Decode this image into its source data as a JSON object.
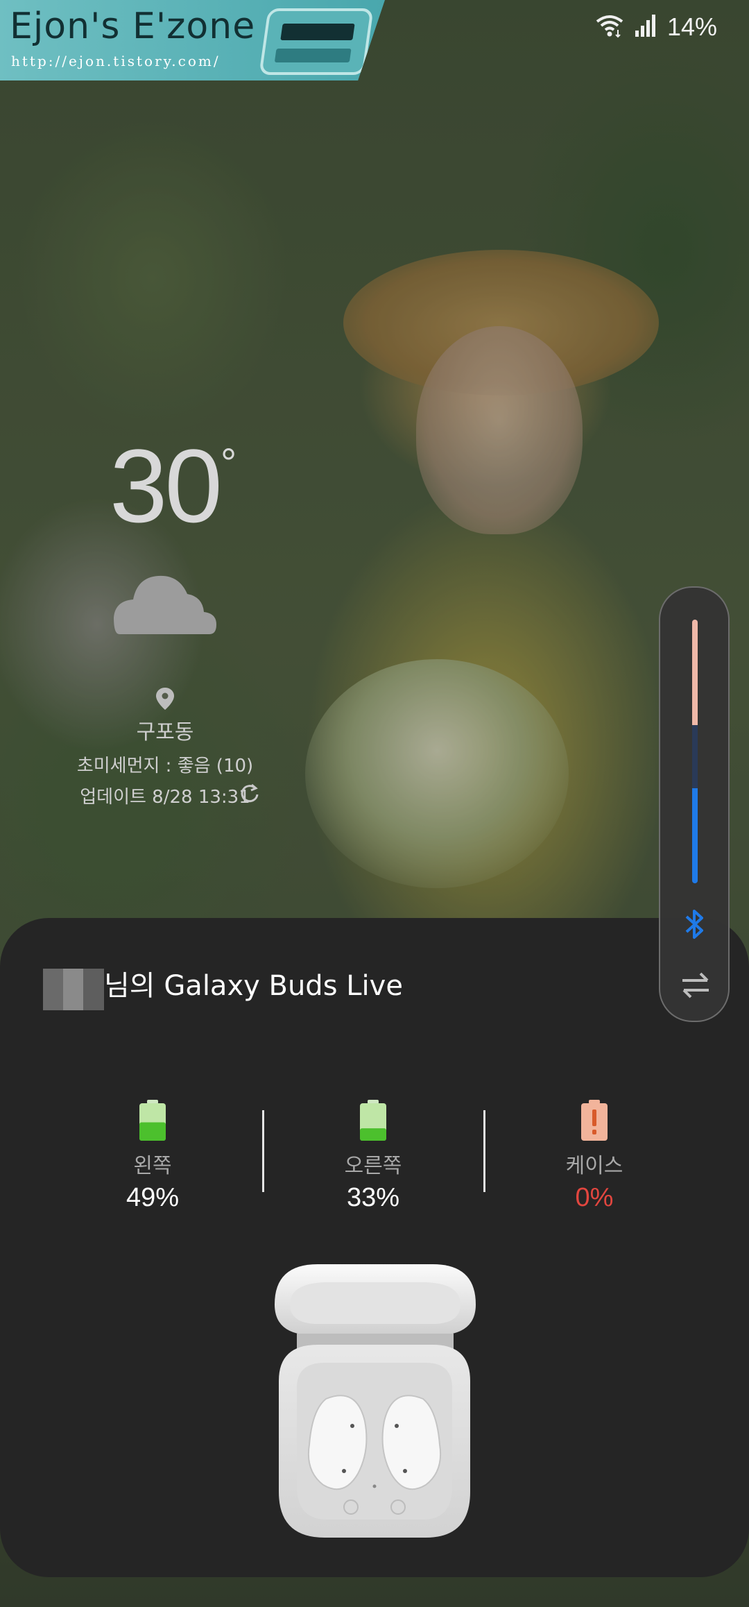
{
  "blog_badge": {
    "title": "Ejon's E'zone",
    "url": "http://ejon.tistory.com/"
  },
  "status_bar": {
    "battery_percent": "14%",
    "icons": [
      "wifi-icon",
      "signal-icon"
    ]
  },
  "weather": {
    "temperature": "30",
    "degree_symbol": "°",
    "condition_icon": "cloud-icon",
    "location": "구포동",
    "air_quality": "초미세먼지 : 좋음 (10)",
    "updated": "업데이트 8/28 13:31"
  },
  "volume_panel": {
    "media_level_fraction": 0.36,
    "upper_level_fraction": 0.4,
    "icons": [
      "bluetooth-icon",
      "swap-output-icon"
    ],
    "colors": {
      "accent": "#1f7ae8",
      "upper": "#f0b9a9"
    }
  },
  "buds": {
    "title": "님의 Galaxy Buds Live",
    "left": {
      "label": "왼쪽",
      "value": "49%",
      "level": 0.49
    },
    "right": {
      "label": "오른쪽",
      "value": "33%",
      "level": 0.33
    },
    "case": {
      "label": "케이스",
      "value": "0%",
      "level": 0
    },
    "colors": {
      "battery_green": "#4cc02d",
      "case_warning": "#f2b49b",
      "case_value": "#e2463f"
    }
  }
}
